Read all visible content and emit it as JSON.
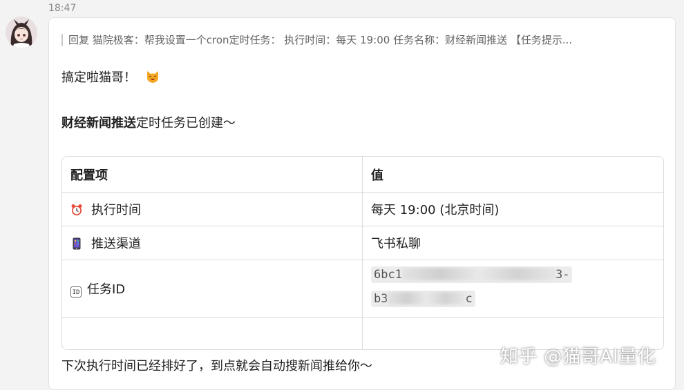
{
  "timestamp": "18:47",
  "reply_quote": "回复 猫院极客：帮我设置一个cron定时任务： 执行时间：每天 19:00 任务名称：财经新闻推送 【任务提示...",
  "greeting": "搞定啦猫哥！",
  "task_created": {
    "name": "财经新闻推送",
    "suffix": "定时任务已创建～"
  },
  "table": {
    "headers": [
      "配置项",
      "值"
    ],
    "rows": [
      {
        "icon": "alarm-clock-icon",
        "label": "执行时间",
        "value": "每天 19:00 (北京时间)"
      },
      {
        "icon": "mobile-phone-icon",
        "label": "推送渠道",
        "value": "飞书私聊"
      },
      {
        "icon": "id-icon",
        "icon_text": "ID",
        "label": "任务ID",
        "value_line1_start": "6bc1",
        "value_line1_end": "3-",
        "value_line2_start": "b3",
        "value_line2_end": "c"
      }
    ]
  },
  "footer": "下次执行时间已经排好了，到点就会自动搜新闻推给你～",
  "watermark": "知乎 @猫哥AI量化"
}
